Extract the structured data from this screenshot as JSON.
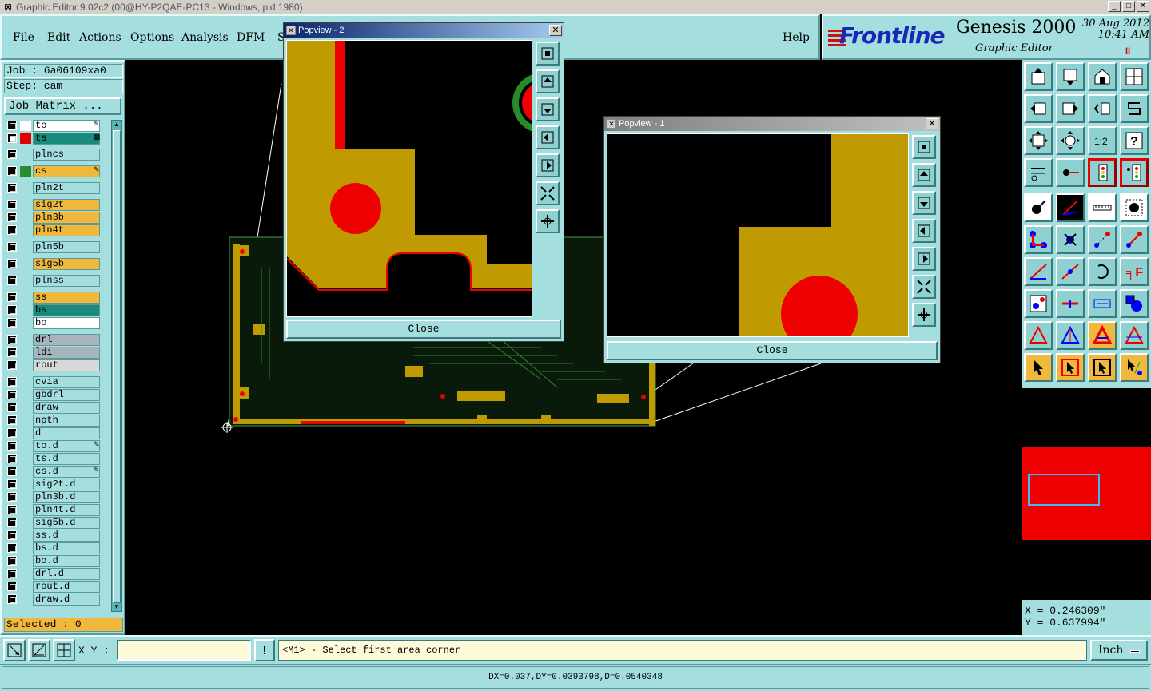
{
  "window": {
    "title": "Graphic Editor 9.02c2 (00@HY-P2QAE-PC13 - Windows, pid:1980)",
    "min": "_",
    "max": "□",
    "close": "✕"
  },
  "menu": {
    "items": [
      "File",
      "Edit",
      "Actions",
      "Options",
      "Analysis",
      "DFM",
      "S"
    ],
    "help": "Help"
  },
  "brand": {
    "logo": "Frontline",
    "product": "Genesis 2000",
    "subtitle": "Graphic Editor",
    "date": "30 Aug 2012",
    "time": "10:41 AM",
    "pause": "II"
  },
  "job": {
    "job_line": "Job : 6a06109xa0",
    "step_line": "Step: cam",
    "matrix_button": "Job Matrix ..."
  },
  "layers": [
    {
      "name": "to",
      "color": "#ffffff",
      "bg": "#ffffff",
      "checked": false,
      "mark": "✎"
    },
    {
      "name": "ts",
      "color": "#e00000",
      "bg": "#1a8a7a",
      "checked": true,
      "mark": "▦"
    },
    {
      "name": "plncs",
      "color": "",
      "bg": "#a5dede",
      "checked": false,
      "mark": ""
    },
    {
      "name": "cs",
      "color": "#2e8a2e",
      "bg": "#f0b83c",
      "checked": false,
      "mark": "✎"
    },
    {
      "name": "pln2t",
      "color": "",
      "bg": "#a5dede",
      "checked": false,
      "mark": ""
    },
    {
      "name": "sig2t",
      "color": "",
      "bg": "#f0b83c",
      "checked": false,
      "mark": ""
    },
    {
      "name": "pln3b",
      "color": "",
      "bg": "#f0b83c",
      "checked": false,
      "mark": ""
    },
    {
      "name": "pln4t",
      "color": "",
      "bg": "#f0b83c",
      "checked": false,
      "mark": ""
    },
    {
      "name": "pln5b",
      "color": "",
      "bg": "#a5dede",
      "checked": false,
      "mark": ""
    },
    {
      "name": "sig5b",
      "color": "",
      "bg": "#f0b83c",
      "checked": false,
      "mark": ""
    },
    {
      "name": "plnss",
      "color": "",
      "bg": "#a5dede",
      "checked": false,
      "mark": ""
    },
    {
      "name": "ss",
      "color": "",
      "bg": "#f0b83c",
      "checked": false,
      "mark": ""
    },
    {
      "name": "bs",
      "color": "",
      "bg": "#1a8a7a",
      "checked": false,
      "mark": ""
    },
    {
      "name": "bo",
      "color": "",
      "bg": "#ffffff",
      "checked": false,
      "mark": ""
    },
    {
      "name": "drl",
      "color": "",
      "bg": "#a8b4bc",
      "checked": false,
      "mark": ""
    },
    {
      "name": "ldi",
      "color": "",
      "bg": "#a8b4bc",
      "checked": false,
      "mark": ""
    },
    {
      "name": "rout",
      "color": "",
      "bg": "#d8d8d8",
      "checked": false,
      "mark": ""
    },
    {
      "name": "cvia",
      "color": "",
      "bg": "#a5dede",
      "checked": false,
      "mark": ""
    },
    {
      "name": "gbdrl",
      "color": "",
      "bg": "#a5dede",
      "checked": false,
      "mark": ""
    },
    {
      "name": "draw",
      "color": "",
      "bg": "#a5dede",
      "checked": false,
      "mark": ""
    },
    {
      "name": "npth",
      "color": "",
      "bg": "#a5dede",
      "checked": false,
      "mark": ""
    },
    {
      "name": "d",
      "color": "",
      "bg": "#a5dede",
      "checked": false,
      "mark": ""
    },
    {
      "name": "to.d",
      "color": "",
      "bg": "#a5dede",
      "checked": false,
      "mark": "✎"
    },
    {
      "name": "ts.d",
      "color": "",
      "bg": "#a5dede",
      "checked": false,
      "mark": ""
    },
    {
      "name": "cs.d",
      "color": "",
      "bg": "#a5dede",
      "checked": false,
      "mark": "✎"
    },
    {
      "name": "sig2t.d",
      "color": "",
      "bg": "#a5dede",
      "checked": false,
      "mark": ""
    },
    {
      "name": "pln3b.d",
      "color": "",
      "bg": "#a5dede",
      "checked": false,
      "mark": ""
    },
    {
      "name": "pln4t.d",
      "color": "",
      "bg": "#a5dede",
      "checked": false,
      "mark": ""
    },
    {
      "name": "sig5b.d",
      "color": "",
      "bg": "#a5dede",
      "checked": false,
      "mark": ""
    },
    {
      "name": "ss.d",
      "color": "",
      "bg": "#a5dede",
      "checked": false,
      "mark": ""
    },
    {
      "name": "bs.d",
      "color": "",
      "bg": "#a5dede",
      "checked": false,
      "mark": ""
    },
    {
      "name": "bo.d",
      "color": "",
      "bg": "#a5dede",
      "checked": false,
      "mark": ""
    },
    {
      "name": "drl.d",
      "color": "",
      "bg": "#a5dede",
      "checked": false,
      "mark": ""
    },
    {
      "name": "rout.d",
      "color": "",
      "bg": "#a5dede",
      "checked": false,
      "mark": ""
    },
    {
      "name": "draw.d",
      "color": "",
      "bg": "#a5dede",
      "checked": false,
      "mark": ""
    }
  ],
  "selected": "Selected : 0",
  "popups": {
    "p2": {
      "title": "Popview - 2",
      "close": "Close"
    },
    "p1": {
      "title": "Popview - 1",
      "close": "Close"
    }
  },
  "coords": {
    "x": "X = 0.246309\"",
    "y": "Y = 0.637994\""
  },
  "bottom": {
    "xy_label": "X Y :",
    "xy_value": "",
    "prompt": "<M1> - Select first area corner",
    "units": "Inch",
    "warn": "!"
  },
  "status": "DX=0.037,DY=0.0393798,D=0.0540348",
  "colors": {
    "panel": "#a5dede",
    "copper": "#bf9a00",
    "pad": "#ff0000",
    "highlight": "#f0b83c"
  }
}
